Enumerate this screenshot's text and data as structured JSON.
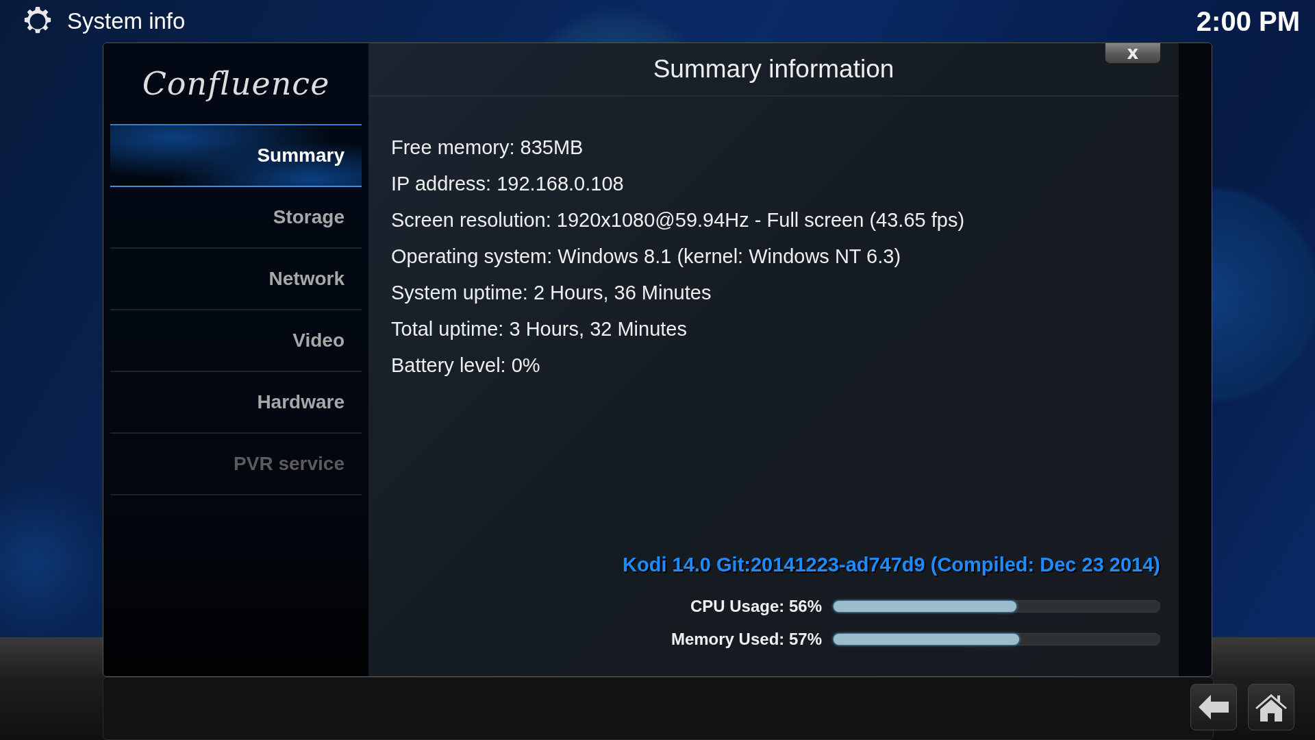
{
  "header": {
    "title": "System info",
    "clock": "2:00 PM"
  },
  "logo": "Confluence",
  "sidebar": {
    "items": [
      {
        "label": "Summary",
        "selected": true,
        "disabled": false
      },
      {
        "label": "Storage",
        "selected": false,
        "disabled": false
      },
      {
        "label": "Network",
        "selected": false,
        "disabled": false
      },
      {
        "label": "Video",
        "selected": false,
        "disabled": false
      },
      {
        "label": "Hardware",
        "selected": false,
        "disabled": false
      },
      {
        "label": "PVR service",
        "selected": false,
        "disabled": true
      }
    ]
  },
  "dialog": {
    "title": "Summary information",
    "close": "x"
  },
  "info_lines": [
    "Free memory: 835MB",
    "IP address: 192.168.0.108",
    "Screen resolution: 1920x1080@59.94Hz - Full screen (43.65 fps)",
    "Operating system: Windows 8.1 (kernel: Windows NT 6.3)",
    "System uptime: 2 Hours, 36 Minutes",
    "Total uptime: 3 Hours, 32 Minutes",
    "Battery level: 0%"
  ],
  "version": "Kodi 14.0 Git:20141223-ad747d9 (Compiled: Dec 23 2014)",
  "meters": [
    {
      "label": "CPU Usage: 56%",
      "level": 0.56
    },
    {
      "label": "Memory Used: 57%",
      "level": 0.57
    }
  ]
}
